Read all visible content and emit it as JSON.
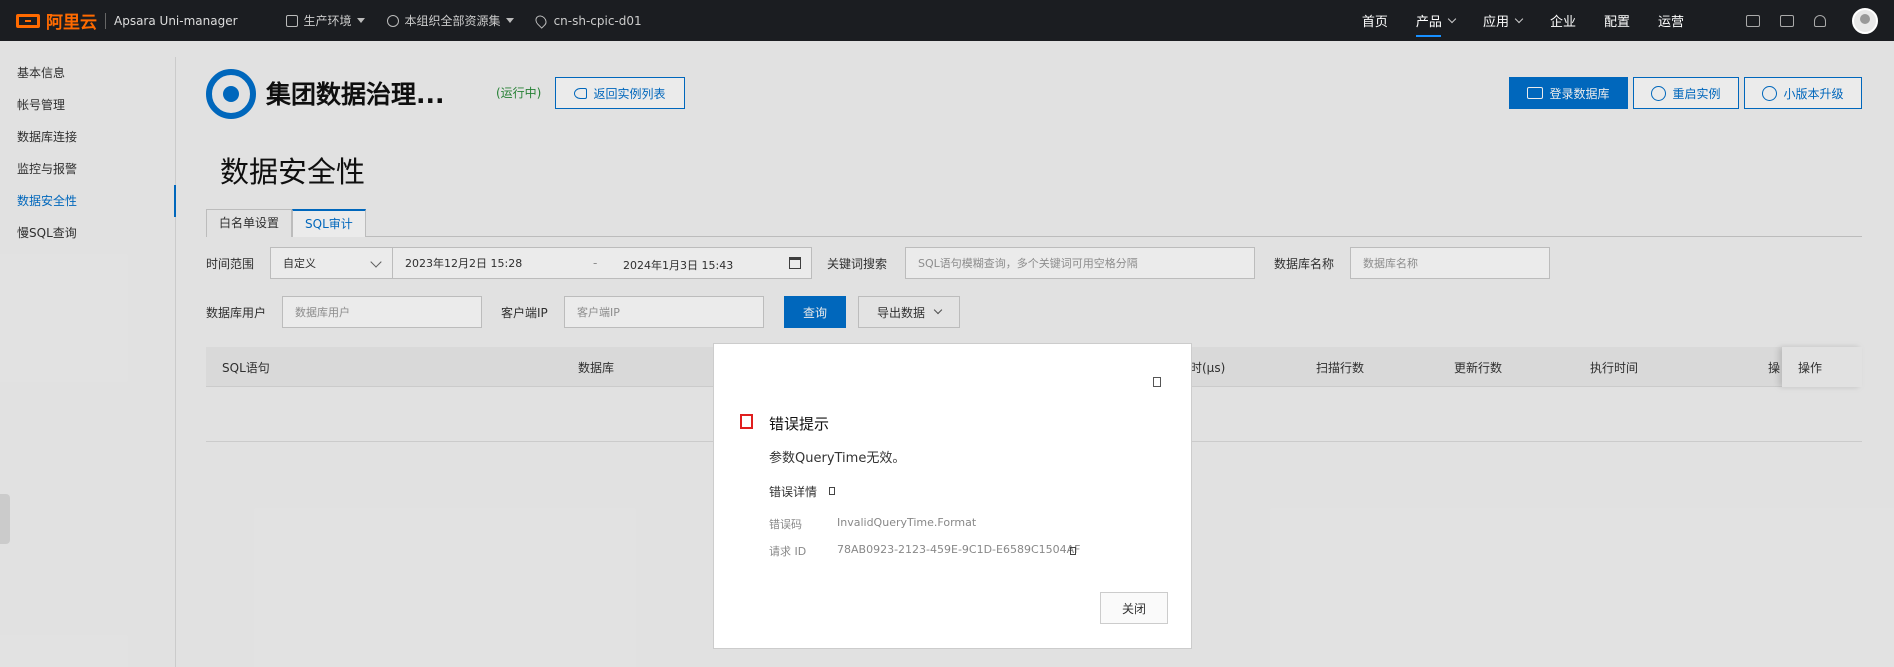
{
  "topbar": {
    "logo_text": "阿里云",
    "product": "Apsara Uni-manager",
    "env": "生产环境",
    "resource_set": "本组织全部资源集",
    "region": "cn-sh-cpic-d01",
    "nav": [
      {
        "label": "首页",
        "dropdown": false,
        "active": false
      },
      {
        "label": "产品",
        "dropdown": true,
        "active": true
      },
      {
        "label": "应用",
        "dropdown": true,
        "active": false
      },
      {
        "label": "企业",
        "dropdown": false,
        "active": false
      },
      {
        "label": "配置",
        "dropdown": false,
        "active": false
      },
      {
        "label": "运营",
        "dropdown": false,
        "active": false
      }
    ]
  },
  "sidebar": {
    "items": [
      {
        "label": "基本信息",
        "active": false
      },
      {
        "label": "帐号管理",
        "active": false
      },
      {
        "label": "数据库连接",
        "active": false
      },
      {
        "label": "监控与报警",
        "active": false
      },
      {
        "label": "数据安全性",
        "active": true
      },
      {
        "label": "慢SQL查询",
        "active": false
      }
    ]
  },
  "instance": {
    "title": "集团数据治理...",
    "status": "(运行中)",
    "back_button": "返回实例列表",
    "login_button": "登录数据库",
    "restart_button": "重启实例",
    "upgrade_button": "小版本升级"
  },
  "page": {
    "title": "数据安全性",
    "tabs": [
      {
        "label": "白名单设置",
        "active": false
      },
      {
        "label": "SQL审计",
        "active": true
      }
    ]
  },
  "filters": {
    "time_range_label": "时间范围",
    "time_mode": "自定义",
    "start_time": "2023年12月2日 15:28",
    "separator": "-",
    "end_time": "2024年1月3日 15:43",
    "keyword_label": "关键词搜索",
    "keyword_placeholder": "SQL语句模糊查询，多个关键词可用空格分隔",
    "db_name_label": "数据库名称",
    "db_name_placeholder": "数据库名称",
    "db_user_label": "数据库用户",
    "db_user_placeholder": "数据库用户",
    "client_ip_label": "客户端IP",
    "client_ip_placeholder": "客户端IP",
    "query_button": "查询",
    "export_button": "导出数据"
  },
  "table": {
    "headers": {
      "sql": "SQL语句",
      "database": "数据库",
      "duration_partial": "时(µs)",
      "scan_rows": "扫描行数",
      "update_rows": "更新行数",
      "exec_time": "执行时间",
      "op_partial": "操",
      "op": "操作"
    }
  },
  "modal": {
    "title": "错误提示",
    "message": "参数QueryTime无效。",
    "detail_label": "错误详情",
    "error_code_label": "错误码",
    "error_code_value": "InvalidQueryTime.Format",
    "request_id_label": "请求 ID",
    "request_id_value": "78AB0923-2123-459E-9C1D-E6589C1504AF",
    "close_button": "关闭"
  },
  "colors": {
    "primary": "#0070cc",
    "error": "#e01f1f",
    "topbar_bg": "#1b1d21",
    "brand": "#ff6a00",
    "running": "#2a8c3a"
  }
}
